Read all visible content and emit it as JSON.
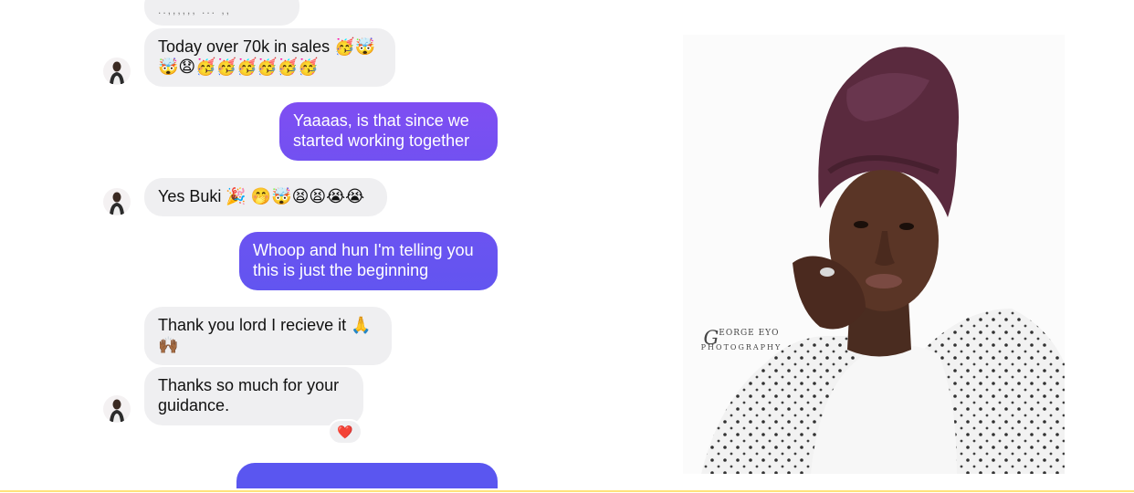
{
  "colors": {
    "incoming_bubble": "#efeff1",
    "outgoing_start": "#7b4df2",
    "outgoing_end": "#5a55f0",
    "bottom_divider": "#ffe27a",
    "reaction_heart": "#e0202e",
    "scarf": "#5a2a3e"
  },
  "conversation": {
    "top_fragment": "..,,,,,, ... ,,",
    "messages": [
      {
        "side": "incoming",
        "text": "Today over 70k in sales 🥳🤯",
        "text2": "🤯😧🥳🥳🥳🥳🥳🥳"
      },
      {
        "side": "outgoing",
        "text": "Yaaaas, is that since we",
        "text2": "started working together"
      },
      {
        "side": "incoming",
        "text": "Yes Buki 🎉 🤭🤯😫😫😭😭"
      },
      {
        "side": "outgoing",
        "text": "Whoop and hun I'm telling you",
        "text2": "this is just the beginning"
      },
      {
        "side": "incoming",
        "text": "Thank you lord I recieve it 🙏",
        "text2": "🙌🏾"
      },
      {
        "side": "incoming",
        "text": "Thanks so much for your",
        "text2": "guidance.",
        "reaction": "❤️"
      }
    ]
  },
  "photo": {
    "watermark_script": "G",
    "watermark_name": "EORGE EYO",
    "watermark_sub": "PHOTOGRAPHY"
  },
  "icons": {
    "avatar": "avatar-icon",
    "reaction": "heart-icon"
  }
}
